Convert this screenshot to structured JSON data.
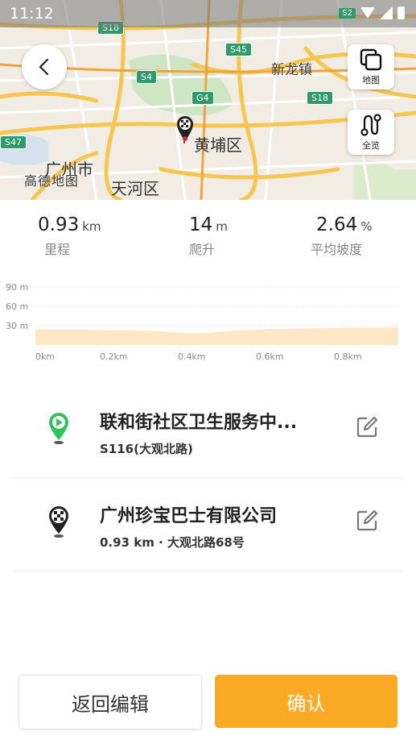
{
  "status_bar": {
    "time": "11:12",
    "badge": "S2"
  },
  "map": {
    "labels": {
      "xinlong": "新龙镇",
      "huangpu": "黄埔区",
      "guangzhou": "广州市",
      "tianhe": "天河区",
      "gaode": "高德地图"
    },
    "road_badges": {
      "s18_top": "S18",
      "s45": "S45",
      "s4": "S4",
      "g4": "G4",
      "s18_right": "S18",
      "s47": "S47"
    },
    "controls": {
      "map_label": "地图",
      "overview_label": "全览"
    }
  },
  "stats": {
    "distance": {
      "value": "0.93",
      "unit": "km",
      "label": "里程"
    },
    "climb": {
      "value": "14",
      "unit": "m",
      "label": "爬升"
    },
    "slope": {
      "value": "2.64",
      "unit": "%",
      "label": "平均坡度"
    }
  },
  "chart_data": {
    "type": "area",
    "y_ticks": [
      "90 m",
      "60 m",
      "30 m"
    ],
    "x_ticks": [
      "0km",
      "0.2km",
      "0.4km",
      "0.6km",
      "0.8km"
    ],
    "ylim": [
      0,
      90
    ],
    "xlim": [
      0,
      0.93
    ],
    "x": [
      0,
      0.05,
      0.1,
      0.2,
      0.3,
      0.4,
      0.45,
      0.5,
      0.55,
      0.6,
      0.7,
      0.8,
      0.9,
      0.93
    ],
    "y": [
      24,
      24,
      24,
      23,
      22,
      18,
      19,
      22,
      23,
      25,
      26,
      27,
      27,
      27
    ],
    "grid": true,
    "fill_color": "#fde7c4"
  },
  "start_point": {
    "title": "联和街社区卫生服务中...",
    "subtitle": "S116(大观北路)"
  },
  "end_point": {
    "title": "广州珍宝巴士有限公司",
    "subtitle": "0.93  km · 大观北路68号"
  },
  "buttons": {
    "back_edit": "返回编辑",
    "confirm": "确认"
  },
  "colors": {
    "accent": "#fbaa25",
    "start_green": "#2fc35c"
  }
}
